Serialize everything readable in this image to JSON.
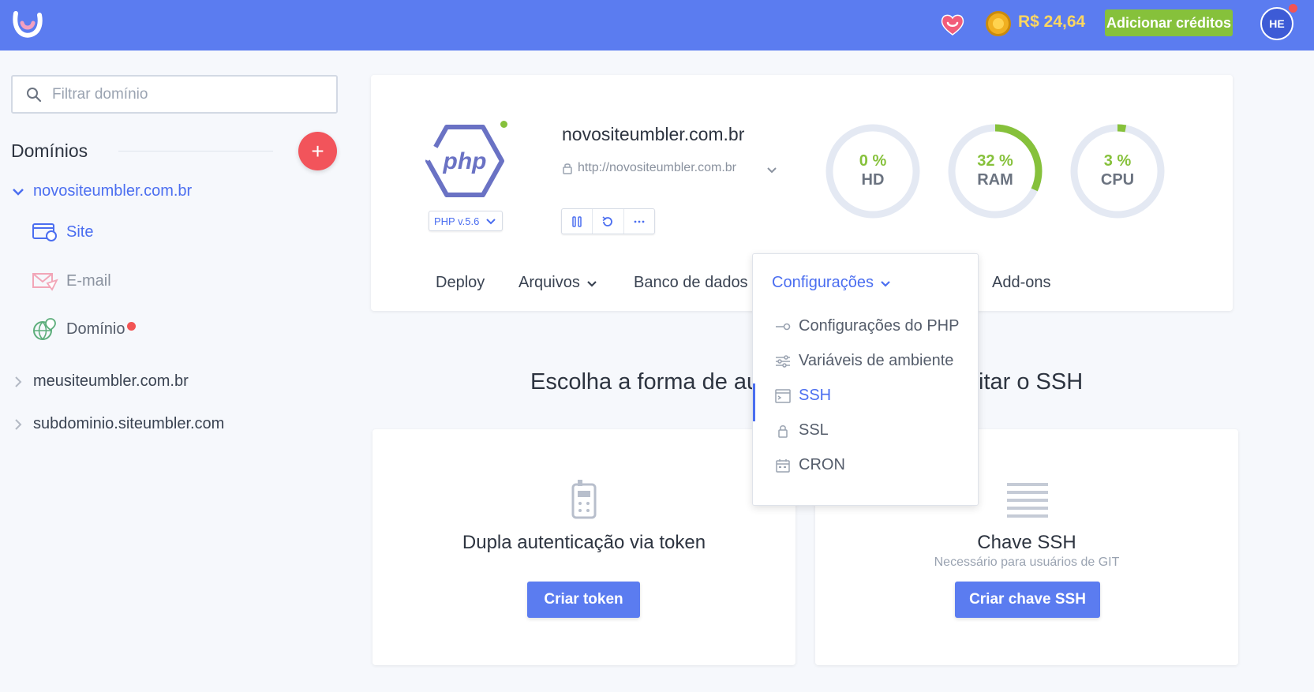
{
  "topbar": {
    "balance": "R$ 24,64",
    "add_credits": "Adicionar créditos",
    "avatar_initials": "HE"
  },
  "sidebar": {
    "filter_placeholder": "Filtrar domínio",
    "domains_title": "Domínios",
    "add_symbol": "+",
    "domains": [
      {
        "name": "novositeumbler.com.br",
        "expanded": true
      },
      {
        "name": "meusiteumbler.com.br",
        "expanded": false
      },
      {
        "name": "subdominio.siteumbler.com",
        "expanded": false
      }
    ],
    "sub_items": [
      {
        "label": "Site",
        "icon": "site-icon"
      },
      {
        "label": "E-mail",
        "icon": "email-icon"
      },
      {
        "label": "Domínio",
        "icon": "globe-icon"
      }
    ]
  },
  "site": {
    "name": "novositeumbler.com.br",
    "url": "http://novositeumbler.com.br",
    "php_version": "PHP v.5.6",
    "logo_text": "php"
  },
  "gauges": [
    {
      "value": 0,
      "value_text": "0 %",
      "label": "HD"
    },
    {
      "value": 32,
      "value_text": "32 %",
      "label": "RAM"
    },
    {
      "value": 3,
      "value_text": "3 %",
      "label": "CPU"
    }
  ],
  "tabs": [
    "Deploy",
    "Arquivos",
    "Banco de dados",
    "Configurações",
    "Add-ons"
  ],
  "dropdown": {
    "items": [
      {
        "label": "Configurações do PHP",
        "icon": "toggle-icon"
      },
      {
        "label": "Variáveis de ambiente",
        "icon": "sliders-icon"
      },
      {
        "label": "SSH",
        "icon": "terminal-icon"
      },
      {
        "label": "SSL",
        "icon": "lock-icon"
      },
      {
        "label": "CRON",
        "icon": "calendar-icon"
      }
    ]
  },
  "section": {
    "title_left": "Escolha a forma de au",
    "title_right": "itar o SSH"
  },
  "cards": [
    {
      "title": "Dupla autenticação via token",
      "subtitle": "",
      "button": "Criar token"
    },
    {
      "title": "Chave SSH",
      "subtitle": "Necessário para usuários de GIT",
      "button": "Criar chave SSH"
    }
  ],
  "colors": {
    "primary": "#5b7cf0",
    "accent_green": "#86c13b",
    "danger": "#f2545b"
  }
}
